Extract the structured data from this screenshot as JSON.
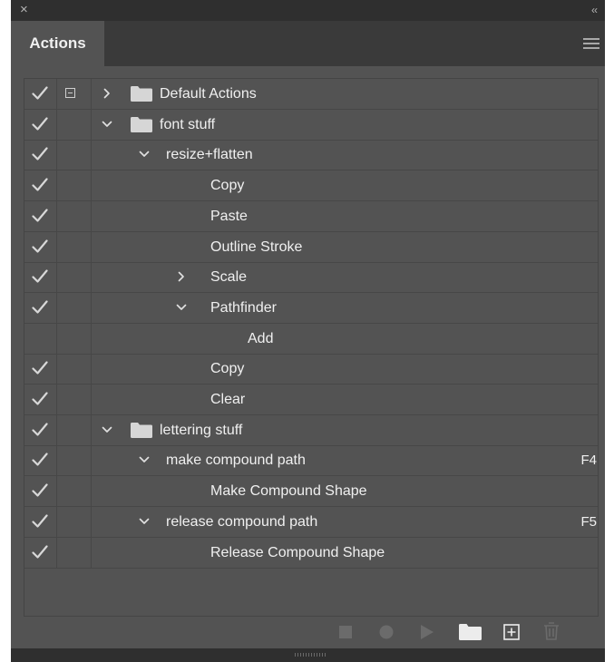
{
  "window": {
    "close_glyph": "×",
    "collapse_glyph": "‹‹"
  },
  "panel": {
    "tab_label": "Actions"
  },
  "rows": [
    {
      "label": "Default Actions",
      "checked": true,
      "dialog": true,
      "chevron": "right",
      "folder": true,
      "level": 0,
      "key": ""
    },
    {
      "label": "font stuff",
      "checked": true,
      "dialog": false,
      "chevron": "down",
      "folder": true,
      "level": 0,
      "key": ""
    },
    {
      "label": "resize+flatten",
      "checked": true,
      "dialog": false,
      "chevron": "down",
      "folder": false,
      "level": 1,
      "key": ""
    },
    {
      "label": "Copy",
      "checked": true,
      "dialog": false,
      "chevron": "",
      "folder": false,
      "level": 2,
      "key": ""
    },
    {
      "label": "Paste",
      "checked": true,
      "dialog": false,
      "chevron": "",
      "folder": false,
      "level": 2,
      "key": ""
    },
    {
      "label": "Outline Stroke",
      "checked": true,
      "dialog": false,
      "chevron": "",
      "folder": false,
      "level": 2,
      "key": ""
    },
    {
      "label": "Scale",
      "checked": true,
      "dialog": false,
      "chevron": "right",
      "folder": false,
      "level": 2,
      "key": ""
    },
    {
      "label": "Pathfinder",
      "checked": true,
      "dialog": false,
      "chevron": "down",
      "folder": false,
      "level": 2,
      "key": ""
    },
    {
      "label": "Add",
      "checked": false,
      "dialog": false,
      "chevron": "",
      "folder": false,
      "level": 3,
      "key": ""
    },
    {
      "label": "Copy",
      "checked": true,
      "dialog": false,
      "chevron": "",
      "folder": false,
      "level": 2,
      "key": ""
    },
    {
      "label": "Clear",
      "checked": true,
      "dialog": false,
      "chevron": "",
      "folder": false,
      "level": 2,
      "key": ""
    },
    {
      "label": "lettering stuff",
      "checked": true,
      "dialog": false,
      "chevron": "down",
      "folder": true,
      "level": 0,
      "key": ""
    },
    {
      "label": "make compound path",
      "checked": true,
      "dialog": false,
      "chevron": "down",
      "folder": false,
      "level": 1,
      "key": "F4"
    },
    {
      "label": "Make Compound Shape",
      "checked": true,
      "dialog": false,
      "chevron": "",
      "folder": false,
      "level": 2,
      "key": ""
    },
    {
      "label": "release compound path",
      "checked": true,
      "dialog": false,
      "chevron": "down",
      "folder": false,
      "level": 1,
      "key": "F5"
    },
    {
      "label": "Release Compound Shape",
      "checked": true,
      "dialog": false,
      "chevron": "",
      "folder": false,
      "level": 2,
      "key": ""
    }
  ],
  "bottom_buttons": [
    {
      "name": "stop-playing-recording-button",
      "icon": "stop-icon",
      "enabled": false
    },
    {
      "name": "begin-recording-button",
      "icon": "record-icon",
      "enabled": false
    },
    {
      "name": "play-selection-button",
      "icon": "play-icon",
      "enabled": false
    },
    {
      "name": "create-new-set-button",
      "icon": "folder-icon",
      "enabled": true
    },
    {
      "name": "create-new-action-button",
      "icon": "new-item-icon",
      "enabled": true
    },
    {
      "name": "delete-selection-button",
      "icon": "trash-icon",
      "enabled": false
    }
  ],
  "colors": {
    "panel": "#535353",
    "titlebar": "#2f2f2f",
    "text": "#f0f0f0",
    "check": "#d8d8d8",
    "folder": "#d6d6d6",
    "disabled": "#6b6b6b"
  }
}
